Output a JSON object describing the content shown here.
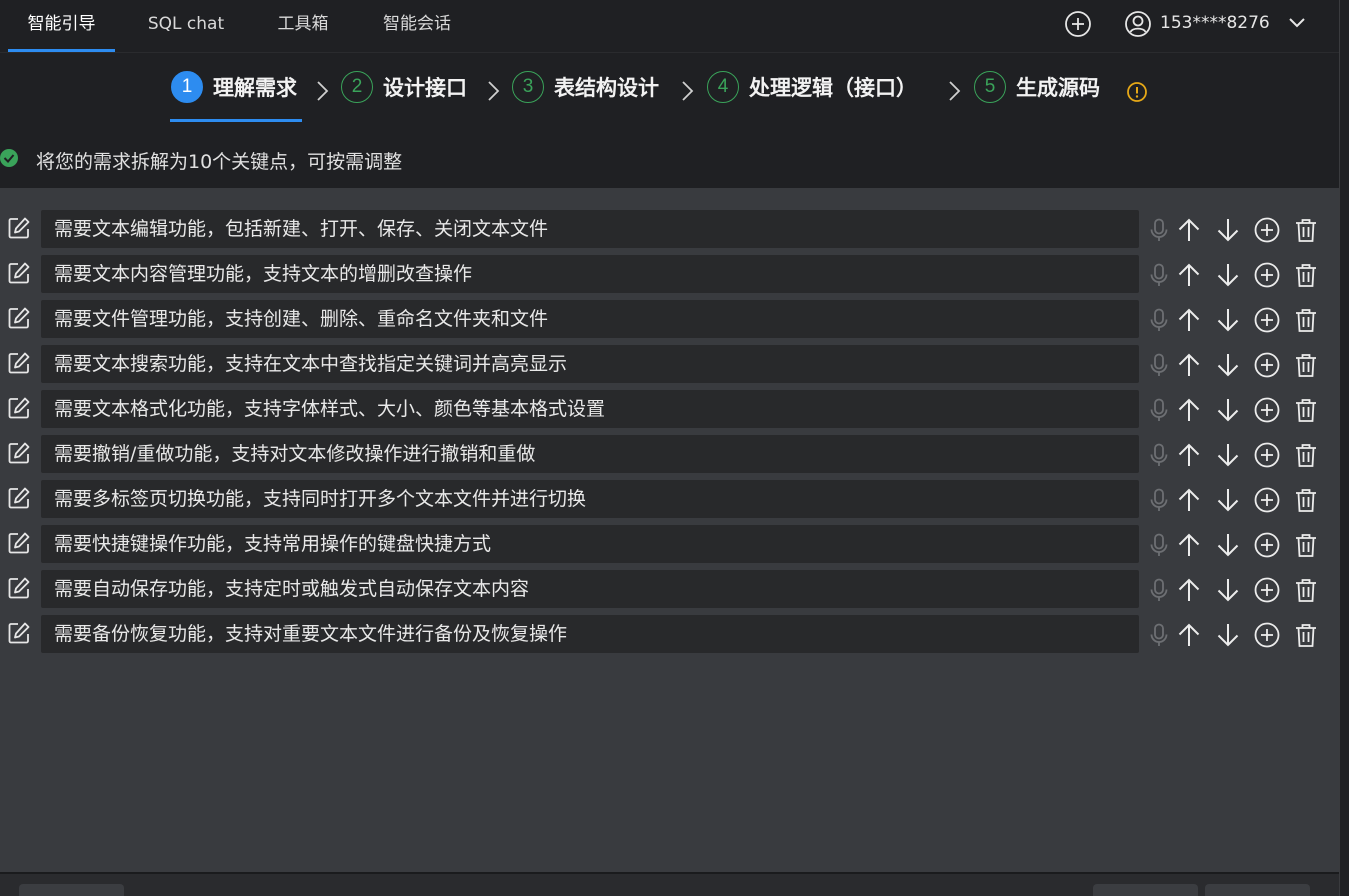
{
  "nav": {
    "tabs": [
      {
        "label": "智能引导"
      },
      {
        "label": "SQL chat"
      },
      {
        "label": "工具箱"
      },
      {
        "label": "智能会话"
      }
    ],
    "user": "153****8276"
  },
  "steps": [
    {
      "number": "1",
      "label": "理解需求"
    },
    {
      "number": "2",
      "label": "设计接口"
    },
    {
      "number": "3",
      "label": "表结构设计"
    },
    {
      "number": "4",
      "label": "处理逻辑（接口）"
    },
    {
      "number": "5",
      "label": "生成源码"
    }
  ],
  "status": {
    "text": "将您的需求拆解为10个关键点，可按需调整"
  },
  "requirements": [
    "需要文本编辑功能，包括新建、打开、保存、关闭文本文件",
    "需要文本内容管理功能，支持文本的增删改查操作",
    "需要文件管理功能，支持创建、删除、重命名文件夹和文件",
    "需要文本搜索功能，支持在文本中查找指定关键词并高亮显示",
    "需要文本格式化功能，支持字体样式、大小、颜色等基本格式设置",
    "需要撤销/重做功能，支持对文本修改操作进行撤销和重做",
    "需要多标签页切换功能，支持同时打开多个文本文件并进行切换",
    "需要快捷键操作功能，支持常用操作的键盘快捷方式",
    "需要自动保存功能，支持定时或触发式自动保存文本内容",
    "需要备份恢复功能，支持对重要文本文件进行备份及恢复操作"
  ],
  "colors": {
    "accent": "#2d8cf0",
    "step_done": "#3aa35a",
    "info": "#e6a817"
  },
  "icons": {
    "row_actions": [
      "microphone-icon",
      "arrow-up-icon",
      "arrow-down-icon",
      "plus-circle-icon",
      "trash-icon"
    ]
  }
}
